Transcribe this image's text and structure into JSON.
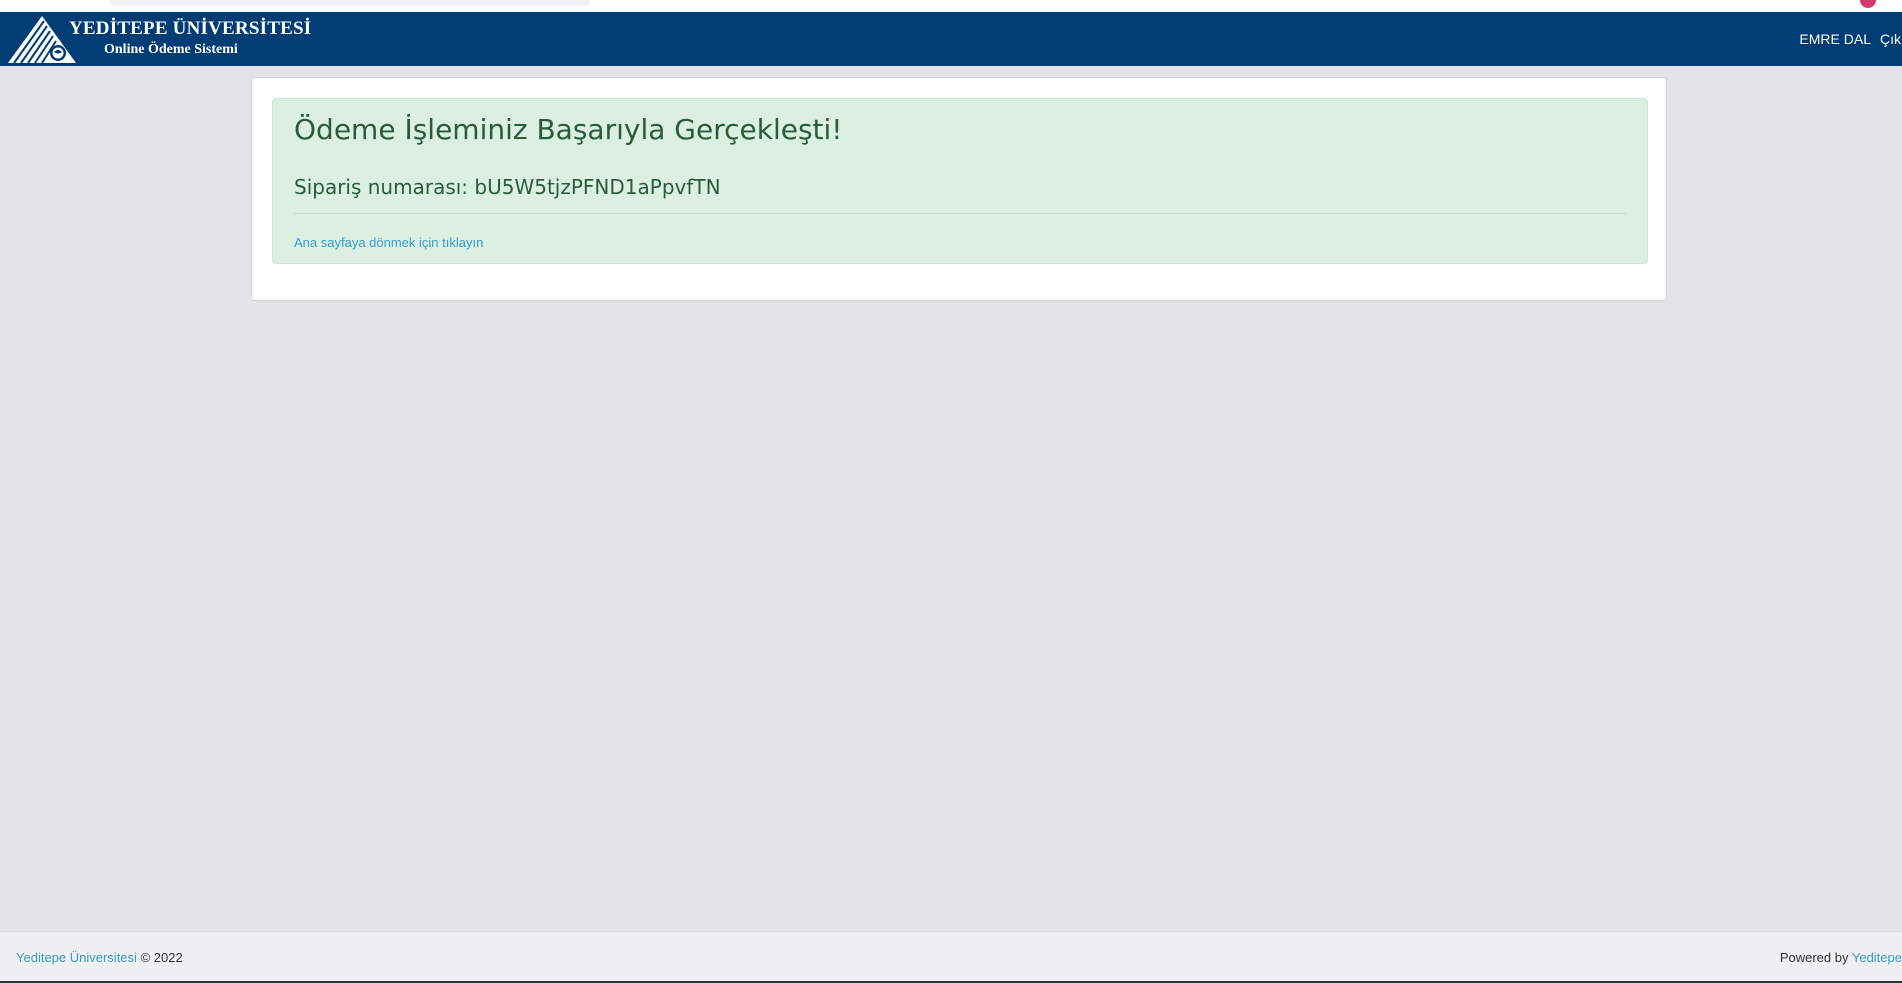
{
  "header": {
    "brand_title": "YEDİTEPE ÜNİVERSİTESİ",
    "brand_subtitle": "Online Ödeme Sistemi",
    "user_name": "EMRE DAL",
    "logout_label": "Çıkış",
    "background_color": "#003d75",
    "logo_icon": "university-logo-icon"
  },
  "alert": {
    "heading": "Ödeme İşleminiz Başarıyla Gerçekleşti!",
    "order_label": "Sipariş numarası:",
    "order_number": "bU5W5tjzPFND1aPpvfTN",
    "home_link": "Ana sayfaya dönmek için tıklayın",
    "background_color": "#dbf0e2",
    "text_color": "#2b5b3a"
  },
  "footer": {
    "university_link": "Yeditepe Üniversitesi",
    "copyright": "© 2022",
    "powered_by_label": "Powered by",
    "powered_by_link": "Yeditepe",
    "link_color": "#3a9bc8"
  }
}
